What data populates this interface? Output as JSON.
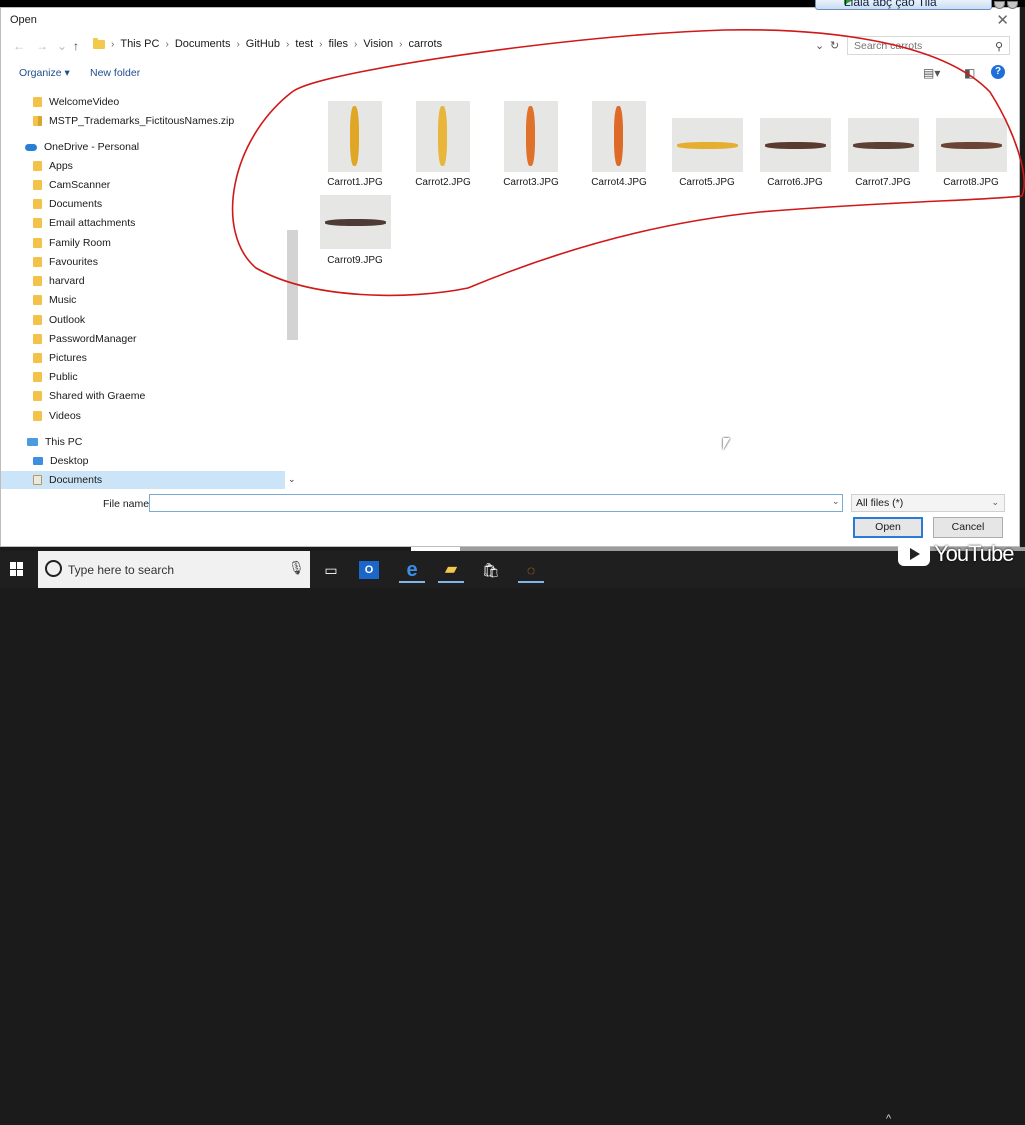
{
  "dialog": {
    "title": "Open",
    "close_glyph": "✕"
  },
  "extension_bar": {
    "label": "Liaia abç çao Tilã"
  },
  "address_bar": {
    "back_glyph": "←",
    "forward_glyph": "→",
    "dropdown_glyph": "⌄",
    "up_glyph": "↑",
    "crumbs": [
      "This PC",
      "Documents",
      "GitHub",
      "test",
      "files",
      "Vision",
      "carrots"
    ],
    "refresh_glyph": "↻",
    "search_placeholder": "Search carrots"
  },
  "command_bar": {
    "organize": "Organize ▾",
    "new_folder": "New folder"
  },
  "nav_pane": {
    "items": [
      {
        "label": "WelcomeVideo",
        "icon": "folder"
      },
      {
        "label": "MSTP_Trademarks_FictitousNames.zip",
        "icon": "zip"
      },
      {
        "label": "OneDrive - Personal",
        "icon": "cloud"
      },
      {
        "label": "Apps",
        "icon": "folder"
      },
      {
        "label": "CamScanner",
        "icon": "folder"
      },
      {
        "label": "Documents",
        "icon": "folder"
      },
      {
        "label": "Email attachments",
        "icon": "folder"
      },
      {
        "label": "Family Room",
        "icon": "folder"
      },
      {
        "label": "Favourites",
        "icon": "folder"
      },
      {
        "label": "harvard",
        "icon": "folder"
      },
      {
        "label": "Music",
        "icon": "folder"
      },
      {
        "label": "Outlook",
        "icon": "folder"
      },
      {
        "label": "PasswordManager",
        "icon": "folder"
      },
      {
        "label": "Pictures",
        "icon": "folder"
      },
      {
        "label": "Public",
        "icon": "folder"
      },
      {
        "label": "Shared with Graeme",
        "icon": "folder"
      },
      {
        "label": "Videos",
        "icon": "folder"
      },
      {
        "label": "This PC",
        "icon": "pc"
      },
      {
        "label": "Desktop",
        "icon": "desktop"
      },
      {
        "label": "Documents",
        "icon": "documents"
      }
    ]
  },
  "files": [
    {
      "name": "Carrot1.JPG",
      "orientation": "portrait",
      "color": "#e0a626"
    },
    {
      "name": "Carrot2.JPG",
      "orientation": "portrait",
      "color": "#e7b63a"
    },
    {
      "name": "Carrot3.JPG",
      "orientation": "portrait",
      "color": "#e0712a"
    },
    {
      "name": "Carrot4.JPG",
      "orientation": "portrait",
      "color": "#de6a28"
    },
    {
      "name": "Carrot5.JPG",
      "orientation": "landscape",
      "color": "#e5ae2e"
    },
    {
      "name": "Carrot6.JPG",
      "orientation": "landscape",
      "color": "#5a3a2e"
    },
    {
      "name": "Carrot7.JPG",
      "orientation": "landscape",
      "color": "#5c4034"
    },
    {
      "name": "Carrot8.JPG",
      "orientation": "landscape",
      "color": "#6b4436"
    },
    {
      "name": "Carrot9.JPG",
      "orientation": "landscape",
      "color": "#4e3a36"
    }
  ],
  "footer": {
    "file_name_label": "File name:",
    "file_name_value": "",
    "filter": "All files (*)",
    "open": "Open",
    "cancel": "Cancel"
  },
  "taskbar": {
    "search_placeholder": "Type here to search"
  },
  "overlay": {
    "youtube": "YouTube",
    "progress_fraction": 0.08
  },
  "colors": {
    "lasso": "#d01818",
    "selection": "#cce4f7",
    "accent": "#2c7ad6"
  }
}
